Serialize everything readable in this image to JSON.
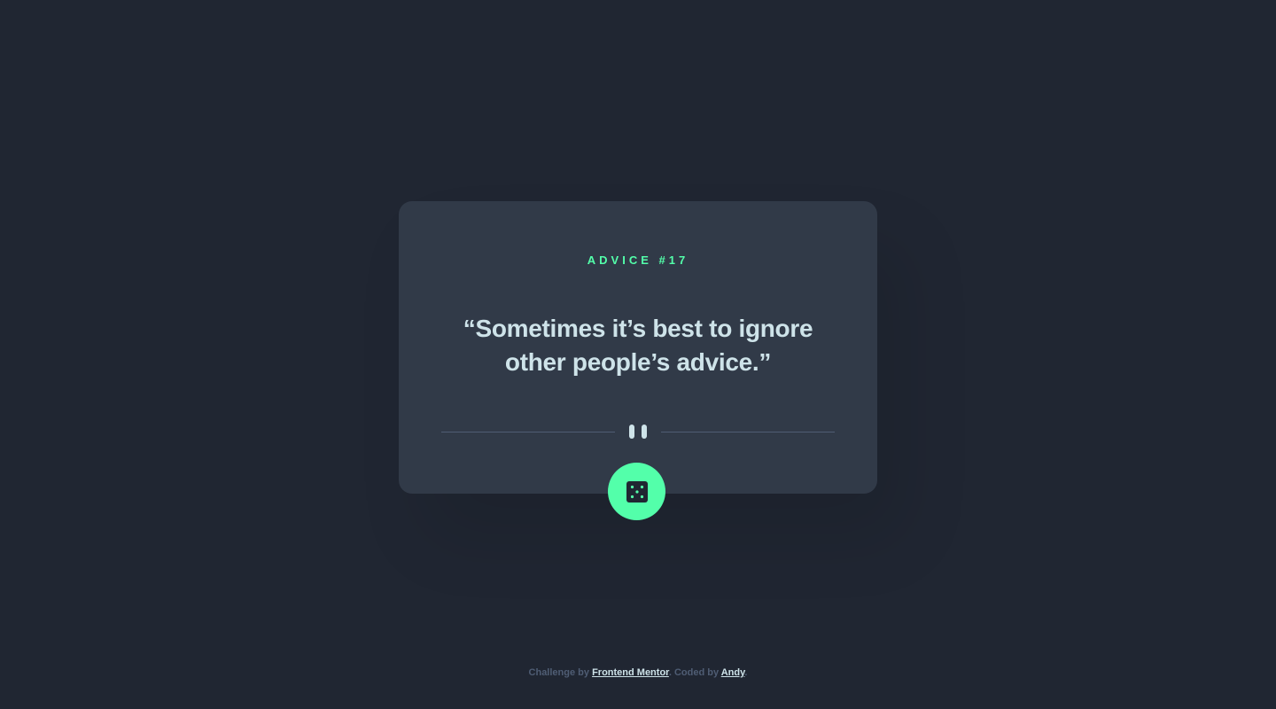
{
  "card": {
    "advice_label": "ADVICE #17",
    "quote": "“Sometimes it’s best to ignore other people’s advice.”"
  },
  "divider": {
    "icon": "pause-icon"
  },
  "dice_button": {
    "icon": "dice-icon"
  },
  "footer": {
    "challenge_prefix": "Challenge by ",
    "challenge_link": "Frontend Mentor",
    "coded_prefix": ". Coded by ",
    "coded_link": "Andy",
    "suffix": "."
  },
  "colors": {
    "background": "#202632",
    "card": "#313a48",
    "accent": "#53ffaa",
    "text": "#cee3e9",
    "muted": "#4f5d74"
  }
}
